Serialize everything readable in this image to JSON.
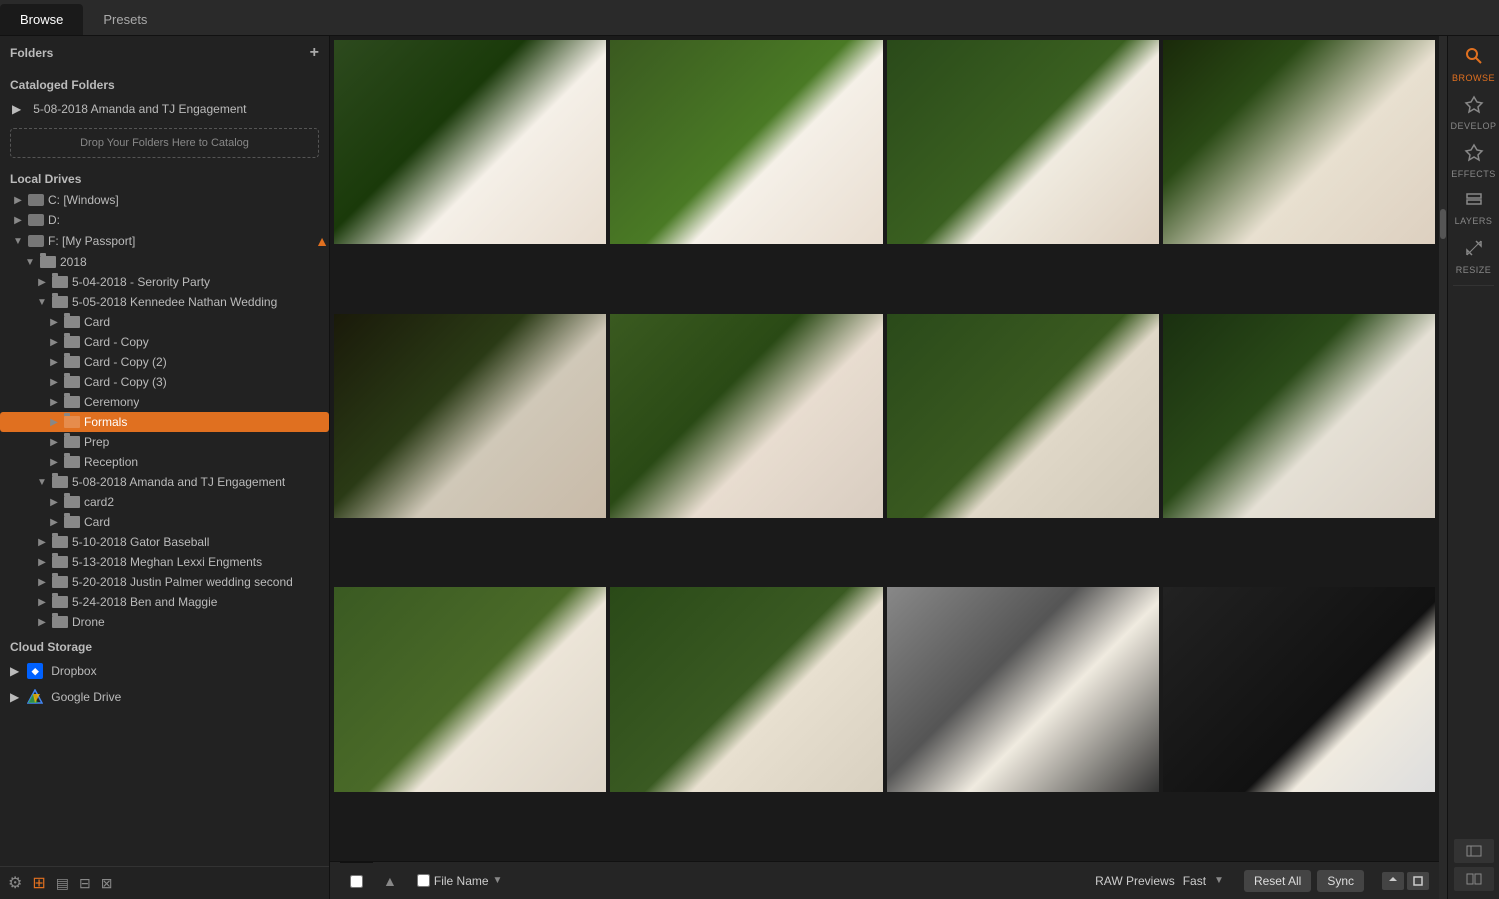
{
  "tabs": {
    "browse": "Browse",
    "presets": "Presets"
  },
  "sidebar": {
    "folders_header": "Folders",
    "cataloged_header": "Cataloged Folders",
    "cataloged_item": "5-08-2018 Amanda and TJ Engagement",
    "drop_zone": "Drop Your Folders Here to Catalog",
    "local_drives_header": "Local Drives",
    "drives": [
      {
        "label": "C: [Windows]",
        "indent": 1
      },
      {
        "label": "D:",
        "indent": 1,
        "eject": false
      },
      {
        "label": "F: [My Passport]",
        "indent": 1,
        "eject": true
      }
    ],
    "year_2018": "2018",
    "tree": [
      {
        "label": "5-04-2018 - Serority Party",
        "indent": 3
      },
      {
        "label": "5-05-2018 Kennedee Nathan Wedding",
        "indent": 3
      },
      {
        "label": "Card",
        "indent": 4
      },
      {
        "label": "Card - Copy",
        "indent": 4
      },
      {
        "label": "Card - Copy (2)",
        "indent": 4
      },
      {
        "label": "Card - Copy (3)",
        "indent": 4
      },
      {
        "label": "Ceremony",
        "indent": 4
      },
      {
        "label": "Formals",
        "indent": 4,
        "active": true
      },
      {
        "label": "Prep",
        "indent": 4
      },
      {
        "label": "Reception",
        "indent": 4
      },
      {
        "label": "5-08-2018 Amanda and TJ Engagement",
        "indent": 3
      },
      {
        "label": "card2",
        "indent": 4
      },
      {
        "label": "Card",
        "indent": 4
      },
      {
        "label": "5-10-2018 Gator Baseball",
        "indent": 3
      },
      {
        "label": "5-13-2018 Meghan Lexxi Engments",
        "indent": 3
      },
      {
        "label": "5-20-2018 Justin Palmer wedding second",
        "indent": 3
      },
      {
        "label": "5-24-2018 Ben and Maggie",
        "indent": 3
      },
      {
        "label": "Drone",
        "indent": 3
      }
    ],
    "cloud_header": "Cloud Storage",
    "cloud_items": [
      {
        "label": "Dropbox",
        "type": "dropbox"
      },
      {
        "label": "Google Drive",
        "type": "gdrive"
      }
    ]
  },
  "right_sidebar": {
    "buttons": [
      {
        "label": "BROWSE",
        "active": true,
        "icon": "🔍"
      },
      {
        "label": "DEVELOP",
        "active": false,
        "icon": "✦"
      },
      {
        "label": "EFFECTS",
        "active": false,
        "icon": "✦"
      },
      {
        "label": "LAYERS",
        "active": false,
        "icon": "▤"
      },
      {
        "label": "RESIZE",
        "active": false,
        "icon": "⤡"
      }
    ]
  },
  "bottom_bar": {
    "sort_label": "File Name",
    "raw_label": "RAW Previews",
    "raw_speed": "Fast",
    "reset_btn": "Reset All",
    "sync_btn": "Sync"
  },
  "photos": [
    {
      "id": 1,
      "class": "photo-1"
    },
    {
      "id": 2,
      "class": "photo-2"
    },
    {
      "id": 3,
      "class": "photo-3"
    },
    {
      "id": 4,
      "class": "photo-4"
    },
    {
      "id": 5,
      "class": "photo-5"
    },
    {
      "id": 6,
      "class": "photo-6"
    },
    {
      "id": 7,
      "class": "photo-7"
    },
    {
      "id": 8,
      "class": "photo-8"
    },
    {
      "id": 9,
      "class": "photo-9"
    },
    {
      "id": 10,
      "class": "photo-10"
    },
    {
      "id": 11,
      "class": "photo-11"
    },
    {
      "id": 12,
      "class": "photo-12"
    }
  ]
}
